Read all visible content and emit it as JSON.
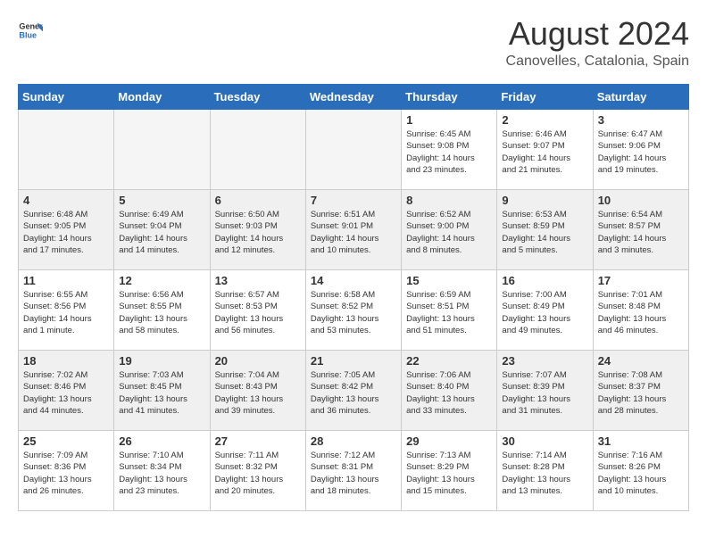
{
  "header": {
    "logo_line1": "General",
    "logo_line2": "Blue",
    "month_year": "August 2024",
    "location": "Canovelles, Catalonia, Spain"
  },
  "days_of_week": [
    "Sunday",
    "Monday",
    "Tuesday",
    "Wednesday",
    "Thursday",
    "Friday",
    "Saturday"
  ],
  "weeks": [
    [
      {
        "day": "",
        "info": ""
      },
      {
        "day": "",
        "info": ""
      },
      {
        "day": "",
        "info": ""
      },
      {
        "day": "",
        "info": ""
      },
      {
        "day": "1",
        "info": "Sunrise: 6:45 AM\nSunset: 9:08 PM\nDaylight: 14 hours\nand 23 minutes."
      },
      {
        "day": "2",
        "info": "Sunrise: 6:46 AM\nSunset: 9:07 PM\nDaylight: 14 hours\nand 21 minutes."
      },
      {
        "day": "3",
        "info": "Sunrise: 6:47 AM\nSunset: 9:06 PM\nDaylight: 14 hours\nand 19 minutes."
      }
    ],
    [
      {
        "day": "4",
        "info": "Sunrise: 6:48 AM\nSunset: 9:05 PM\nDaylight: 14 hours\nand 17 minutes."
      },
      {
        "day": "5",
        "info": "Sunrise: 6:49 AM\nSunset: 9:04 PM\nDaylight: 14 hours\nand 14 minutes."
      },
      {
        "day": "6",
        "info": "Sunrise: 6:50 AM\nSunset: 9:03 PM\nDaylight: 14 hours\nand 12 minutes."
      },
      {
        "day": "7",
        "info": "Sunrise: 6:51 AM\nSunset: 9:01 PM\nDaylight: 14 hours\nand 10 minutes."
      },
      {
        "day": "8",
        "info": "Sunrise: 6:52 AM\nSunset: 9:00 PM\nDaylight: 14 hours\nand 8 minutes."
      },
      {
        "day": "9",
        "info": "Sunrise: 6:53 AM\nSunset: 8:59 PM\nDaylight: 14 hours\nand 5 minutes."
      },
      {
        "day": "10",
        "info": "Sunrise: 6:54 AM\nSunset: 8:57 PM\nDaylight: 14 hours\nand 3 minutes."
      }
    ],
    [
      {
        "day": "11",
        "info": "Sunrise: 6:55 AM\nSunset: 8:56 PM\nDaylight: 14 hours\nand 1 minute."
      },
      {
        "day": "12",
        "info": "Sunrise: 6:56 AM\nSunset: 8:55 PM\nDaylight: 13 hours\nand 58 minutes."
      },
      {
        "day": "13",
        "info": "Sunrise: 6:57 AM\nSunset: 8:53 PM\nDaylight: 13 hours\nand 56 minutes."
      },
      {
        "day": "14",
        "info": "Sunrise: 6:58 AM\nSunset: 8:52 PM\nDaylight: 13 hours\nand 53 minutes."
      },
      {
        "day": "15",
        "info": "Sunrise: 6:59 AM\nSunset: 8:51 PM\nDaylight: 13 hours\nand 51 minutes."
      },
      {
        "day": "16",
        "info": "Sunrise: 7:00 AM\nSunset: 8:49 PM\nDaylight: 13 hours\nand 49 minutes."
      },
      {
        "day": "17",
        "info": "Sunrise: 7:01 AM\nSunset: 8:48 PM\nDaylight: 13 hours\nand 46 minutes."
      }
    ],
    [
      {
        "day": "18",
        "info": "Sunrise: 7:02 AM\nSunset: 8:46 PM\nDaylight: 13 hours\nand 44 minutes."
      },
      {
        "day": "19",
        "info": "Sunrise: 7:03 AM\nSunset: 8:45 PM\nDaylight: 13 hours\nand 41 minutes."
      },
      {
        "day": "20",
        "info": "Sunrise: 7:04 AM\nSunset: 8:43 PM\nDaylight: 13 hours\nand 39 minutes."
      },
      {
        "day": "21",
        "info": "Sunrise: 7:05 AM\nSunset: 8:42 PM\nDaylight: 13 hours\nand 36 minutes."
      },
      {
        "day": "22",
        "info": "Sunrise: 7:06 AM\nSunset: 8:40 PM\nDaylight: 13 hours\nand 33 minutes."
      },
      {
        "day": "23",
        "info": "Sunrise: 7:07 AM\nSunset: 8:39 PM\nDaylight: 13 hours\nand 31 minutes."
      },
      {
        "day": "24",
        "info": "Sunrise: 7:08 AM\nSunset: 8:37 PM\nDaylight: 13 hours\nand 28 minutes."
      }
    ],
    [
      {
        "day": "25",
        "info": "Sunrise: 7:09 AM\nSunset: 8:36 PM\nDaylight: 13 hours\nand 26 minutes."
      },
      {
        "day": "26",
        "info": "Sunrise: 7:10 AM\nSunset: 8:34 PM\nDaylight: 13 hours\nand 23 minutes."
      },
      {
        "day": "27",
        "info": "Sunrise: 7:11 AM\nSunset: 8:32 PM\nDaylight: 13 hours\nand 20 minutes."
      },
      {
        "day": "28",
        "info": "Sunrise: 7:12 AM\nSunset: 8:31 PM\nDaylight: 13 hours\nand 18 minutes."
      },
      {
        "day": "29",
        "info": "Sunrise: 7:13 AM\nSunset: 8:29 PM\nDaylight: 13 hours\nand 15 minutes."
      },
      {
        "day": "30",
        "info": "Sunrise: 7:14 AM\nSunset: 8:28 PM\nDaylight: 13 hours\nand 13 minutes."
      },
      {
        "day": "31",
        "info": "Sunrise: 7:16 AM\nSunset: 8:26 PM\nDaylight: 13 hours\nand 10 minutes."
      }
    ]
  ]
}
